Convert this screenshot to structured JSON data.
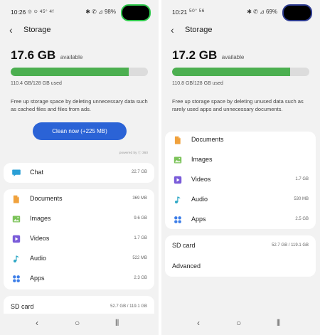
{
  "left": {
    "status": {
      "time": "10:26",
      "left_icons": "◎ ⊙ 45° 4f",
      "right_icons": "✱ ✆ ⊿ 98%"
    },
    "header": {
      "title": "Storage",
      "back_icon": "back-arrow-icon"
    },
    "storage": {
      "available_value": "17.6 GB",
      "available_label": "available",
      "used_fraction": 0.86,
      "used_text": "110.4 GB/128 GB used",
      "description": "Free up storage space by deleting unnecessary data such as cached files and files from ads.",
      "clean_button": "Clean now (+225 MB)",
      "powered_by": "powered by ⓒ 360"
    },
    "chat": {
      "label": "Chat",
      "size": "22.7 GB",
      "icon": "chat-icon",
      "color": "#2a9fd6"
    },
    "categories": [
      {
        "key": "documents",
        "label": "Documents",
        "size": "369 MB",
        "icon": "document-icon",
        "color": "#f0a13c"
      },
      {
        "key": "images",
        "label": "Images",
        "size": "9.6 GB",
        "icon": "image-icon",
        "color": "#7cc35a"
      },
      {
        "key": "videos",
        "label": "Videos",
        "size": "1.7 GB",
        "icon": "video-icon",
        "color": "#7a5cd9"
      },
      {
        "key": "audio",
        "label": "Audio",
        "size": "522 MB",
        "icon": "music-note-icon",
        "color": "#2fa8c6"
      },
      {
        "key": "apps",
        "label": "Apps",
        "size": "2.3 GB",
        "icon": "apps-grid-icon",
        "color": "#3d7ee8"
      }
    ],
    "sd_card": {
      "label": "SD card",
      "size": "52.7 GB / 119.1 GB"
    }
  },
  "right": {
    "status": {
      "time": "10:21",
      "left_icons": "50° 56",
      "right_icons": "✱ ✆ ⊿ 69%"
    },
    "header": {
      "title": "Storage",
      "back_icon": "back-arrow-icon"
    },
    "storage": {
      "available_value": "17.2 GB",
      "available_label": "available",
      "used_fraction": 0.86,
      "used_text": "110.8 GB/128 GB used",
      "description": "Free up storage space by deleting unused data such as rarely used apps and unnecessary documents."
    },
    "categories": [
      {
        "key": "documents",
        "label": "Documents",
        "size": "",
        "icon": "document-icon",
        "color": "#f0a13c"
      },
      {
        "key": "images",
        "label": "Images",
        "size": "",
        "icon": "image-icon",
        "color": "#7cc35a"
      },
      {
        "key": "videos",
        "label": "Videos",
        "size": "1.7 GB",
        "icon": "video-icon",
        "color": "#7a5cd9"
      },
      {
        "key": "audio",
        "label": "Audio",
        "size": "530 MB",
        "icon": "music-note-icon",
        "color": "#2fa8c6"
      },
      {
        "key": "apps",
        "label": "Apps",
        "size": "2.5 GB",
        "icon": "apps-grid-icon",
        "color": "#3d7ee8"
      }
    ],
    "sd_card": {
      "label": "SD card",
      "size": "52.7 GB / 119.1 GB"
    },
    "advanced": {
      "label": "Advanced"
    }
  },
  "navbar": {
    "back": "‹",
    "home": "○",
    "recents": "⦀"
  }
}
